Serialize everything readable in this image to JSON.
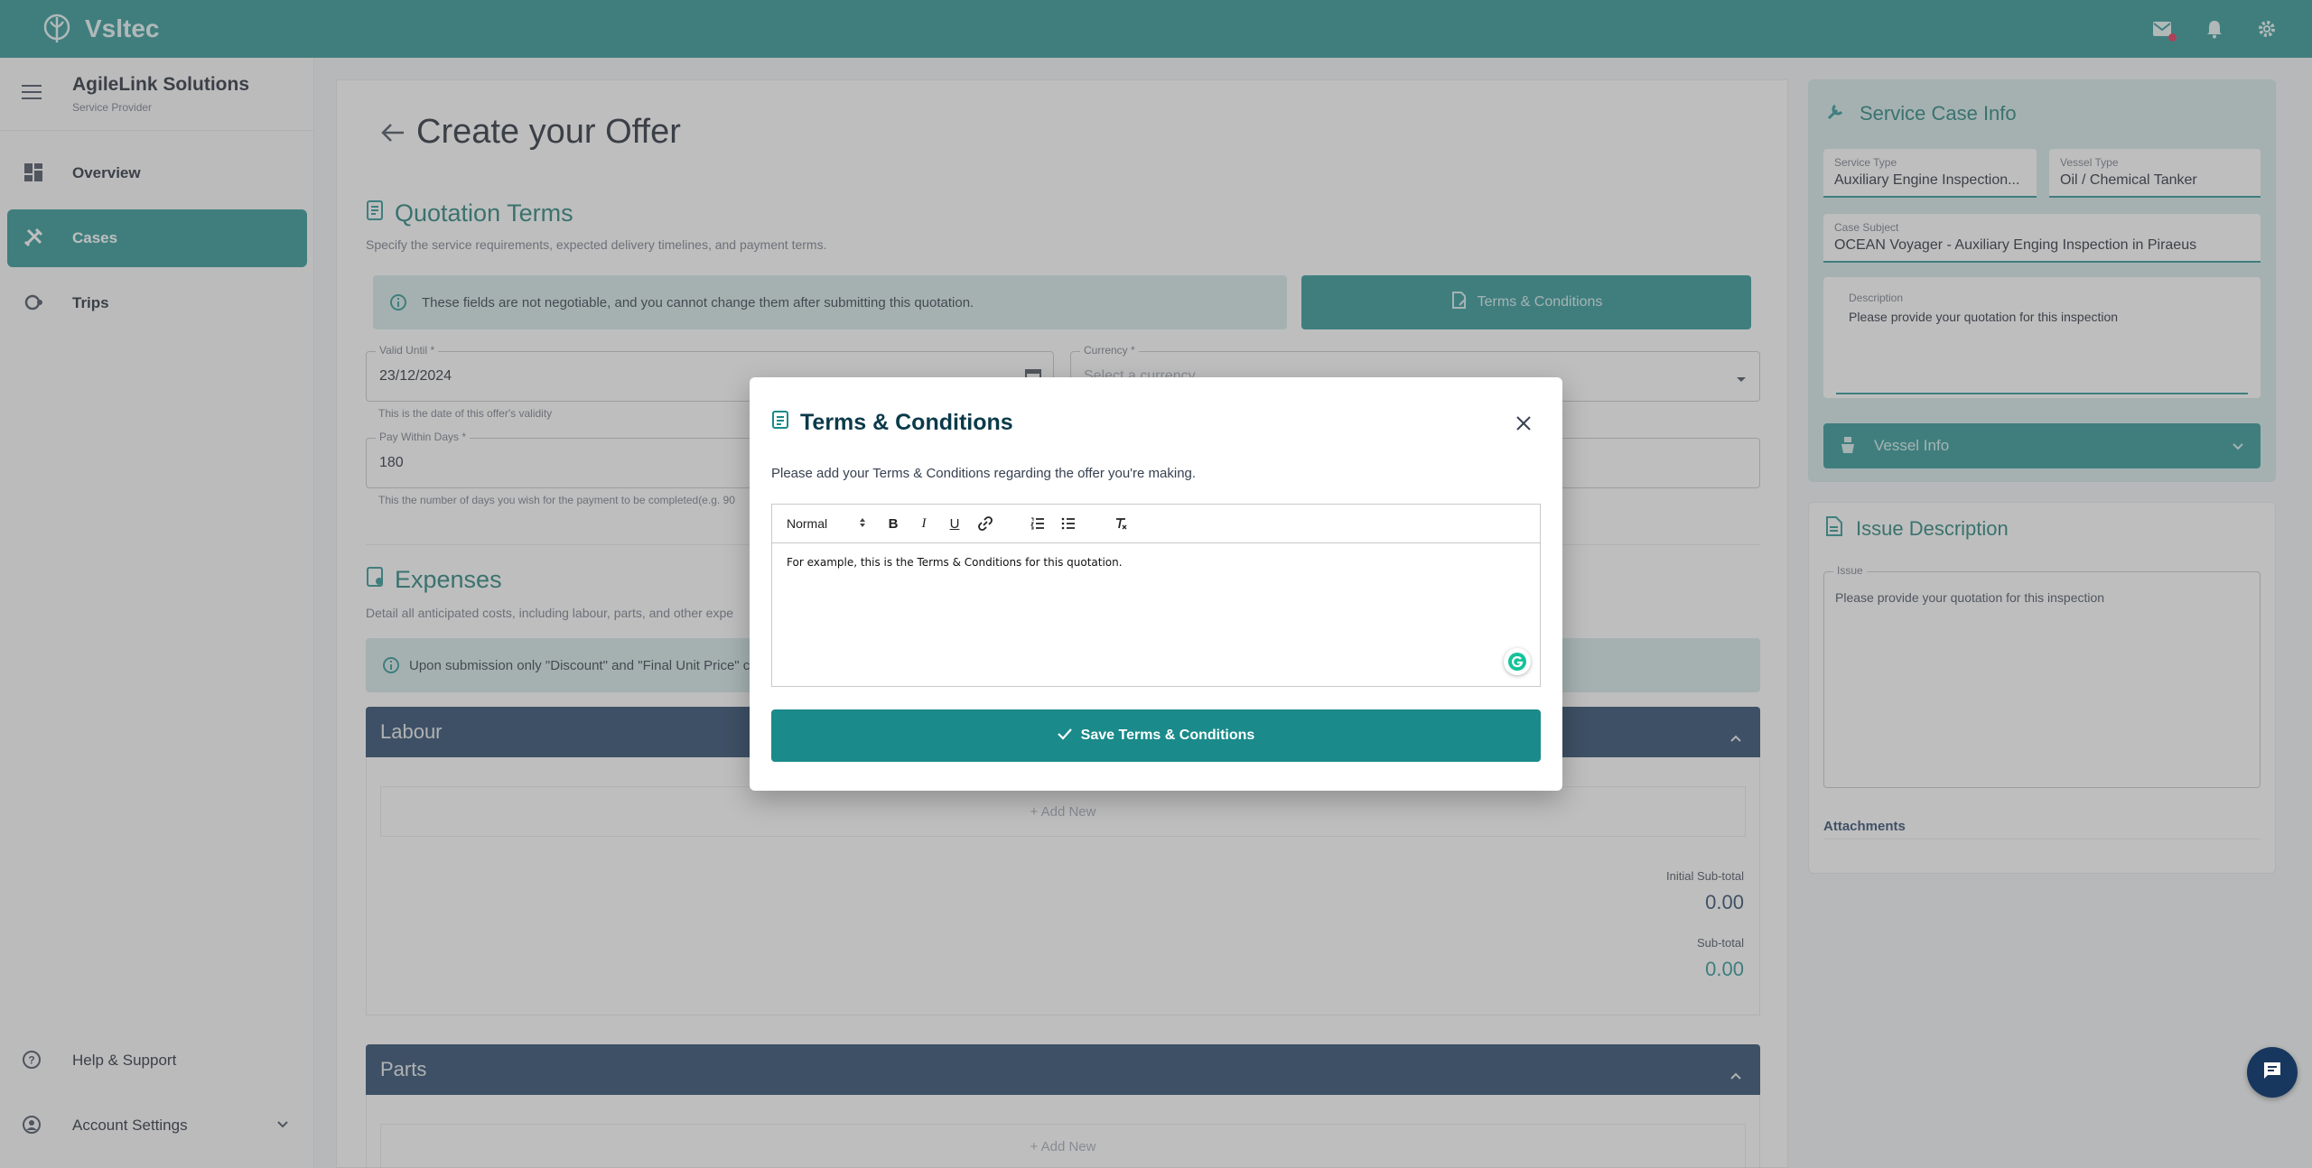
{
  "app": {
    "brand": "Vsltec"
  },
  "sidebar": {
    "company_name": "AgileLink Solutions",
    "company_role": "Service Provider",
    "items": [
      {
        "label": "Overview",
        "icon": "dashboard-icon"
      },
      {
        "label": "Cases",
        "icon": "tools-icon"
      },
      {
        "label": "Trips",
        "icon": "route-icon"
      }
    ],
    "active_item": "Cases",
    "bottom": [
      {
        "label": "Help & Support",
        "icon": "help-icon"
      },
      {
        "label": "Account Settings",
        "icon": "account-icon"
      }
    ]
  },
  "page": {
    "title": "Create your Offer",
    "quotation": {
      "title": "Quotation Terms",
      "subtitle": "Specify the service requirements, expected delivery timelines, and payment terms.",
      "notice": "These fields are not negotiable, and you cannot change them after submitting this quotation.",
      "tc_button": "Terms & Conditions",
      "valid_until_label": "Valid Until *",
      "valid_until_value": "23/12/2024",
      "valid_until_helper": "This is the date of this offer's validity",
      "currency_label": "Currency *",
      "currency_placeholder": "Select a currency",
      "pay_within_label": "Pay Within Days *",
      "pay_within_value": "180",
      "pay_within_helper": "This the number of days you wish for the payment to be completed(e.g. 90"
    },
    "expenses": {
      "title": "Expenses",
      "subtitle": "Detail all anticipated costs, including labour, parts, and other expe",
      "notice": "Upon submission only \"Discount\" and \"Final Unit Price\" can",
      "labour": {
        "title": "Labour",
        "add_new": "+ Add New",
        "initial_subtotal_label": "Initial Sub-total",
        "initial_subtotal_value": "0.00",
        "subtotal_label": "Sub-total",
        "subtotal_value": "0.00"
      },
      "parts": {
        "title": "Parts",
        "add_new": "+ Add New"
      }
    }
  },
  "service_case": {
    "title": "Service Case Info",
    "service_type_label": "Service Type",
    "service_type_value": "Auxiliary Engine Inspection...",
    "vessel_type_label": "Vessel Type",
    "vessel_type_value": "Oil / Chemical Tanker",
    "case_subject_label": "Case Subject",
    "case_subject_value": "OCEAN Voyager - Auxiliary Enging Inspection in Piraeus",
    "description_label": "Description",
    "description_value": "Please provide your quotation for this inspection",
    "vessel_info": "Vessel Info"
  },
  "issue": {
    "title": "Issue Description",
    "issue_label": "Issue",
    "issue_value": "Please provide your quotation for this inspection",
    "attachments": "Attachments"
  },
  "modal": {
    "title": "Terms & Conditions",
    "description": "Please add your Terms & Conditions regarding the offer you're making.",
    "format_select": "Normal",
    "editor_text": "For example, this is the Terms & Conditions for this quotation.",
    "save_button": "Save Terms & Conditions"
  },
  "colors": {
    "primary": "#1a8a8a",
    "navy": "#17375e",
    "accent_light": "#d2e8e8"
  }
}
